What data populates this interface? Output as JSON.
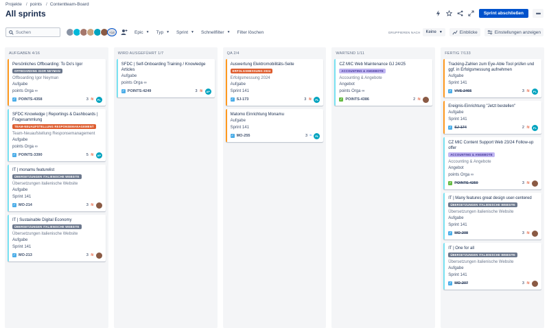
{
  "breadcrumb": [
    "Projekte",
    "points",
    "Contentteam-Board"
  ],
  "page_title": "All sprints",
  "header": {
    "primary_button": "Sprint abschließen"
  },
  "search": {
    "placeholder": "Suchen"
  },
  "avatars": {
    "items": [
      {
        "initials": "",
        "color": "#8993a4"
      },
      {
        "initials": "",
        "color": "#00b8d9"
      },
      {
        "initials": "",
        "color": "#a5776b"
      },
      {
        "initials": "",
        "color": "#c9a27e"
      },
      {
        "initials": "",
        "color": "#00a3bf"
      },
      {
        "initials": "",
        "color": "#8a5a44"
      }
    ],
    "more": "+14"
  },
  "filters": [
    "Epic",
    "Typ",
    "Sprint",
    "Schnellfilter"
  ],
  "clear_filters": "Filter löschen",
  "group_by": {
    "label": "GRUPPIEREN NACH",
    "value": "Keine"
  },
  "toolbar": {
    "insights": "Einblicke",
    "settings": "Einstellungen anzeigen"
  },
  "columns": [
    {
      "header": "AUFGABEN 4/16",
      "cards": [
        {
          "title": "Persönliches Offboarding: To Do's Igor",
          "label": "OFFBOARDING IGOR NEYMAN",
          "label_color": "gray",
          "label_desc": "Offboarding Igor Neyman",
          "type": "Aufgabe",
          "extra": "points Orga ∞",
          "key": "POINTS-4358",
          "done": false,
          "points": "3",
          "prio": "high",
          "assignee_color": "#00a3bf",
          "assignee": "PL",
          "border": "orange"
        },
        {
          "title": "SFDC Knowledge | Reportings & Dashboards | Fragesammlung",
          "label": "TEAM-NEUAUFSTELLUNG RESPONSEMANAGEMENT",
          "label_color": "orange",
          "label_desc": "Team-Neuaufstellung Responsemanagement",
          "type": "Aufgabe",
          "extra": "points Orga ∞",
          "key": "POINTS-3390",
          "done": false,
          "points": "5",
          "prio": "high",
          "assignee_color": "#00a3bf",
          "assignee": "AP",
          "border": "teal"
        },
        {
          "title": "IT | monamu featurelist",
          "label": "ÜBERSETZUNGEN ITALIENISCHE WEBSITE",
          "label_color": "gray",
          "label_desc": "Übersetzungen italienische Website",
          "type": "Aufgabe",
          "extra": "Sprint 141",
          "key": "MO-214",
          "done": false,
          "points": "3",
          "prio": "high",
          "assignee_color": "#8a5a44",
          "assignee": "",
          "border": "teal"
        },
        {
          "title": "IT | Sustainable Digital Economy",
          "label": "ÜBERSETZUNGEN ITALIENISCHE WEBSITE",
          "label_color": "gray",
          "label_desc": "Übersetzungen italienische Website",
          "type": "Aufgabe",
          "extra": "Sprint 141",
          "key": "MO-213",
          "done": false,
          "points": "3",
          "prio": "high",
          "assignee_color": "#8a5a44",
          "assignee": "",
          "border": "teal"
        }
      ]
    },
    {
      "header": "WIRD AUSGEFÜHRT 1/7",
      "cards": [
        {
          "title": "SFDC | Self-Onboarding Training / Knowledge Articles",
          "label": "",
          "label_color": "",
          "label_desc": "",
          "type": "Aufgabe",
          "extra": "points Orga ∞",
          "key": "POINTS-4249",
          "done": false,
          "points": "3",
          "prio": "high",
          "assignee_color": "#00a3bf",
          "assignee": "AP",
          "border": "teal"
        }
      ]
    },
    {
      "header": "QA 2/4",
      "cards": [
        {
          "title": "Auswertung Elektromobilitäts-Seite",
          "label": "ERFOLGSMESSUNG 2024",
          "label_color": "orange",
          "label_desc": "Erfolgsmessung 2024",
          "type": "Aufgabe",
          "extra": "Sprint 141",
          "key": "SJ-173",
          "done": false,
          "points": "3",
          "prio": "high",
          "assignee_color": "#00a3bf",
          "assignee": "PL",
          "border": "orange"
        },
        {
          "title": "Matomo Einrichtung Monamu",
          "label": "",
          "label_color": "",
          "label_desc": "",
          "type": "Aufgabe",
          "extra": "Sprint 141",
          "key": "MO-255",
          "done": false,
          "points": "3",
          "prio": "low",
          "assignee_color": "#00a3bf",
          "assignee": "PL",
          "border": "orange"
        }
      ]
    },
    {
      "header": "WARTEND 1/11",
      "cards": [
        {
          "title": "CZ MIC Web Maintenance GJ 24/25",
          "label": "ACCOUNTING & ANGEBOTE",
          "label_color": "purple",
          "label_desc": "Accounting & Angebote",
          "type": "Angebot",
          "extra": "points Orga ∞",
          "key": "POINTS-4386",
          "done": false,
          "points": "2",
          "prio": "high",
          "assignee_color": "#8a5a44",
          "assignee": "",
          "border": "teal",
          "type_icon": "green"
        }
      ]
    },
    {
      "header": "FERTIG 7/133",
      "cards": [
        {
          "title": "Tracking-Zahlen zum Eye-Able Tool prüfen und ggf. in Erfolgsmessung aufnehmen",
          "label": "",
          "label_color": "",
          "label_desc": "",
          "type": "Aufgabe",
          "extra": "Sprint 141",
          "key": "VVS-2465",
          "done": true,
          "points": "3",
          "prio": "high",
          "assignee_color": "#00a3bf",
          "assignee": "PL",
          "border": "orange"
        },
        {
          "title": "Ereignis-Einrichtung \"Jetzt bestellen\"",
          "label": "",
          "label_color": "",
          "label_desc": "",
          "type": "Aufgabe",
          "extra": "Sprint 141",
          "key": "SJ-174",
          "done": true,
          "points": "2",
          "prio": "high",
          "assignee_color": "#00a3bf",
          "assignee": "PL",
          "border": "orange"
        },
        {
          "title": "CZ MIC Content Support Web 23/24 Follow-up offer",
          "label": "ACCOUNTING & ANGEBOTE",
          "label_color": "purple",
          "label_desc": "Accounting & Angebote",
          "type": "Angebot",
          "extra": "points Orga ∞",
          "key": "POINTS-4250",
          "done": true,
          "points": "3",
          "prio": "high",
          "assignee_color": "#8a5a44",
          "assignee": "",
          "border": "teal",
          "type_icon": "green"
        },
        {
          "title": "IT | Many features great design user-centered",
          "label": "ÜBERSETZUNGEN ITALIENISCHE WEBSITE",
          "label_color": "gray",
          "label_desc": "Übersetzungen italienische Website",
          "type": "Aufgabe",
          "extra": "Sprint 141",
          "key": "MO-208",
          "done": true,
          "points": "3",
          "prio": "high",
          "assignee_color": "#8a5a44",
          "assignee": "",
          "border": "teal"
        },
        {
          "title": "IT | One for all",
          "label": "ÜBERSETZUNGEN ITALIENISCHE WEBSITE",
          "label_color": "gray",
          "label_desc": "Übersetzungen italienische Website",
          "type": "Aufgabe",
          "extra": "Sprint 141",
          "key": "MO-207",
          "done": true,
          "points": "3",
          "prio": "high",
          "assignee_color": "#8a5a44",
          "assignee": "",
          "border": "teal"
        }
      ]
    }
  ]
}
